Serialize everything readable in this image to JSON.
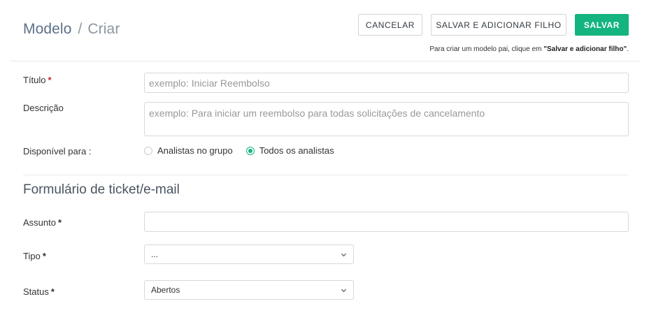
{
  "breadcrumb": {
    "root": "Modelo",
    "separator": "/",
    "current": "Criar"
  },
  "toolbar": {
    "cancel_label": "CANCELAR",
    "save_child_label": "SALVAR E ADICIONAR FILHO",
    "save_label": "SALVAR"
  },
  "hint": {
    "prefix": "Para criar um modelo pai, clique em ",
    "emphasis": "\"Salvar e adicionar filho\"",
    "suffix": "."
  },
  "form": {
    "title": {
      "label": "Título",
      "placeholder": "exemplo: Iniciar Reembolso"
    },
    "description": {
      "label": "Descrição",
      "placeholder": "exemplo: Para iniciar um reembolso para todas solicitações de cancelamento"
    },
    "available_for": {
      "label": "Disponível para :",
      "options": [
        "Analistas no grupo",
        "Todos os analistas"
      ],
      "selected": "Todos os analistas"
    }
  },
  "ticket_section": {
    "title": "Formulário de ticket/e-mail",
    "subject": {
      "label": "Assunto",
      "value": ""
    },
    "type": {
      "label": "Tipo",
      "value": "..."
    },
    "status": {
      "label": "Status",
      "value": "Abertos"
    }
  },
  "colors": {
    "accent": "#13b47f",
    "required": "#c62828"
  }
}
